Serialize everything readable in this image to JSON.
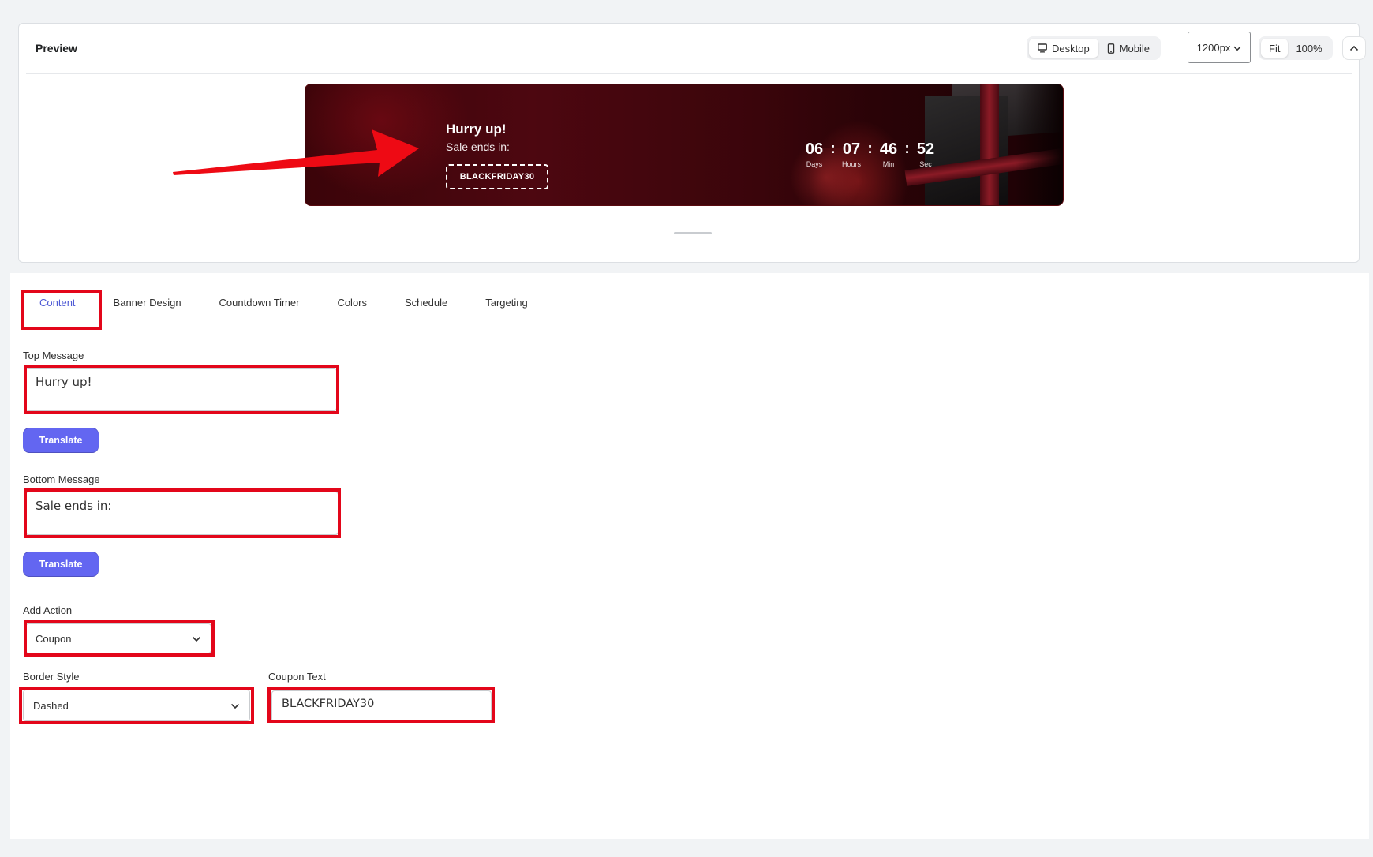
{
  "preview": {
    "title": "Preview",
    "device_buttons": [
      {
        "label": "Desktop",
        "icon": "monitor-icon",
        "active": true
      },
      {
        "label": "Mobile",
        "icon": "phone-icon",
        "active": false
      }
    ],
    "width_select": "1200px",
    "zoom_buttons": [
      {
        "label": "Fit",
        "active": true
      },
      {
        "label": "100%",
        "active": false
      }
    ],
    "collapse_icon": "chevron-up-icon"
  },
  "banner": {
    "top_message": "Hurry up!",
    "bottom_message": "Sale ends in:",
    "coupon": "BLACKFRIDAY30",
    "timer": {
      "days": "06",
      "hours": "07",
      "min": "46",
      "sec": "52",
      "days_label": "Days",
      "hours_label": "Hours",
      "min_label": "Min",
      "sec_label": "Sec",
      "separator": ":"
    },
    "colors": {
      "background": "#3b0409",
      "text": "#ffffff"
    }
  },
  "tabs": [
    {
      "label": "Content",
      "active": true
    },
    {
      "label": "Banner Design",
      "active": false
    },
    {
      "label": "Countdown Timer",
      "active": false
    },
    {
      "label": "Colors",
      "active": false
    },
    {
      "label": "Schedule",
      "active": false
    },
    {
      "label": "Targeting",
      "active": false
    }
  ],
  "form": {
    "top_message_label": "Top Message",
    "top_message_value": "Hurry up!",
    "bottom_message_label": "Bottom Message",
    "bottom_message_value": "Sale ends in:",
    "translate_label": "Translate",
    "add_action_label": "Add Action",
    "add_action_value": "Coupon",
    "border_style_label": "Border Style",
    "border_style_value": "Dashed",
    "coupon_text_label": "Coupon Text",
    "coupon_text_value": "BLACKFRIDAY30"
  },
  "colors": {
    "accent": "#6366f1",
    "active_tab": "#4f5bd5",
    "annotation_red": "#e3061a"
  }
}
